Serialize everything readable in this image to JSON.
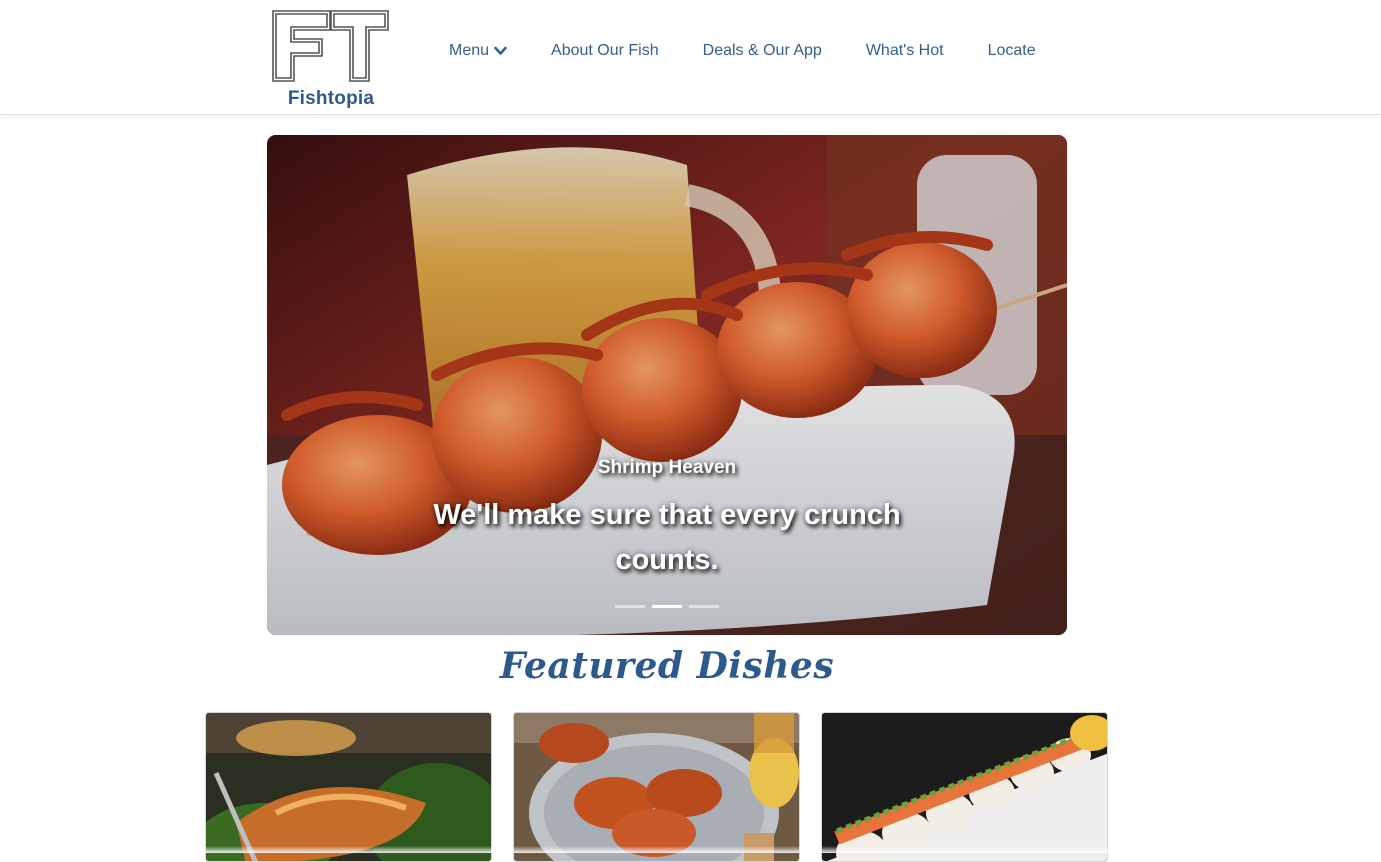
{
  "brand": {
    "logo_letters": "FT",
    "name": "Fishtopia"
  },
  "nav": {
    "items": [
      {
        "label": "Menu",
        "has_dropdown": true
      },
      {
        "label": "About Our Fish"
      },
      {
        "label": "Deals & Our App"
      },
      {
        "label": "What's Hot"
      },
      {
        "label": "Locate"
      }
    ]
  },
  "carousel": {
    "slide_title": "Shrimp Heaven",
    "slide_caption": "We'll make sure that every crunch counts.",
    "active_index": 1,
    "slide_count": 3
  },
  "featured": {
    "title": "Featured Dishes",
    "cards": [
      {
        "image": "glazed-fish-with-greens"
      },
      {
        "image": "steamed-crabs-platter"
      },
      {
        "image": "sushi-roll-platter"
      }
    ]
  },
  "colors": {
    "brand_blue": "#2c5a8e",
    "nav_text": "#355f8c"
  }
}
